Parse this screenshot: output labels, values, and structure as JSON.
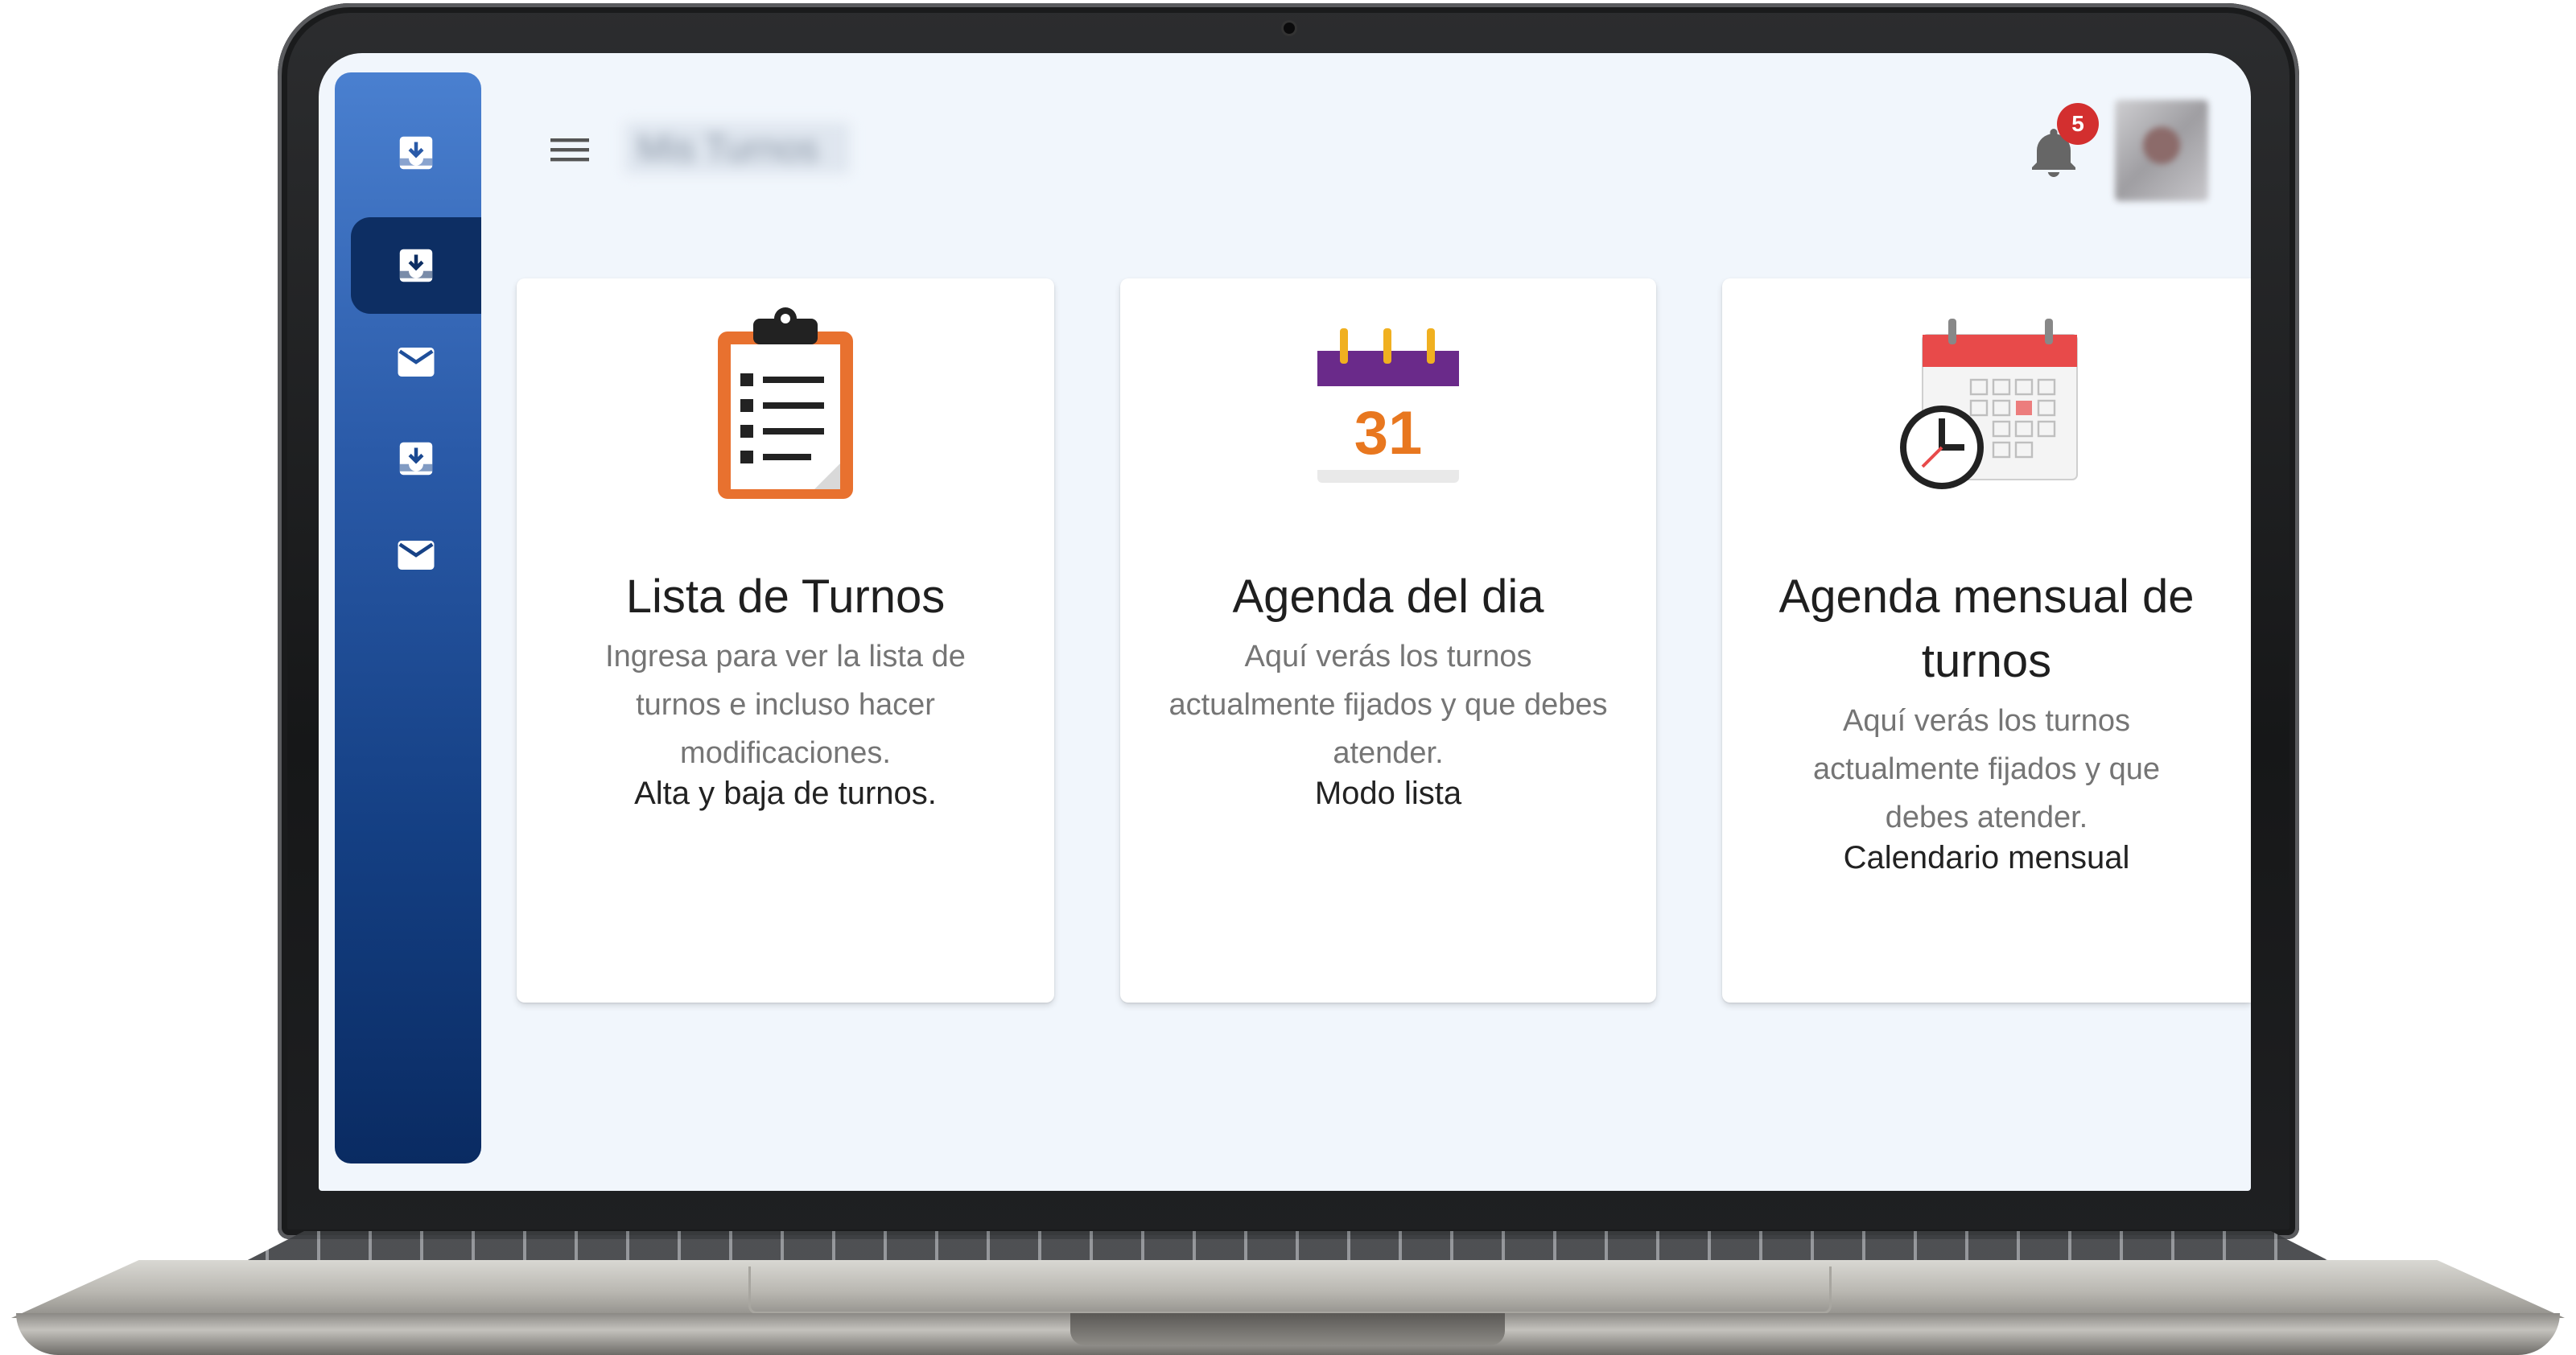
{
  "app": {
    "title": "Mis Turnos",
    "notification_count": "5"
  },
  "sidebar": {
    "items": [
      {
        "icon": "inbox-download-icon"
      },
      {
        "icon": "inbox-download-icon",
        "active": true
      },
      {
        "icon": "mail-icon"
      },
      {
        "icon": "inbox-download-icon"
      },
      {
        "icon": "mail-icon"
      }
    ]
  },
  "cards": [
    {
      "icon": "clipboard-list-icon",
      "title": "Lista de Turnos",
      "description": "Ingresa para ver la lista de turnos e incluso hacer modificaciones.",
      "link": "Alta y baja de turnos."
    },
    {
      "icon": "calendar-day-icon",
      "icon_number": "31",
      "title": "Agenda del dia",
      "description": "Aquí verás los turnos actualmente fijados y que debes atender.",
      "link": "Modo lista"
    },
    {
      "icon": "calendar-clock-icon",
      "title": "Agenda mensual de turnos",
      "description": "Aquí verás los turnos actualmente fijados y que debes atender.",
      "link": "Calendario mensual"
    }
  ],
  "colors": {
    "sidebar_top": "#4a80d0",
    "sidebar_bottom": "#0a2b62",
    "badge": "#d32f2f",
    "screen_bg": "#f1f6fc"
  }
}
